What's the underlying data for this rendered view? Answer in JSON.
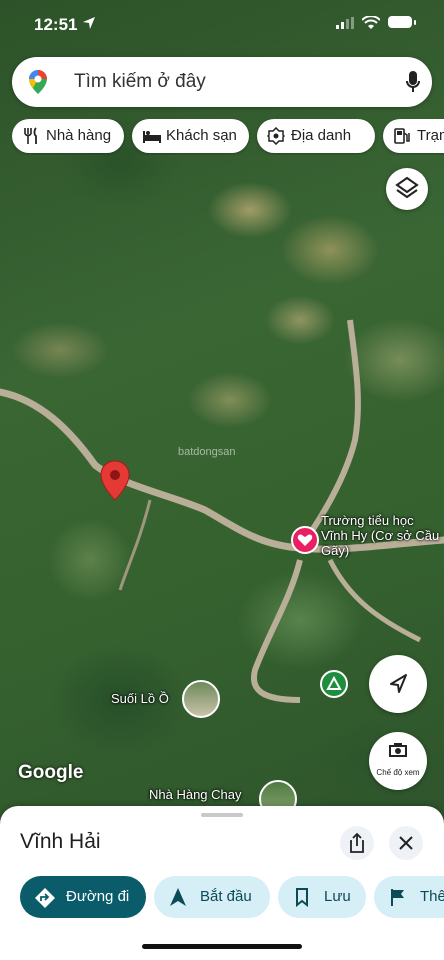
{
  "status_bar": {
    "time": "12:51",
    "location_icon": "location-arrow-icon"
  },
  "search": {
    "placeholder": "Tìm kiếm ở đây"
  },
  "chips": [
    {
      "label": "Nhà hàng",
      "icon": "fork-knife-icon"
    },
    {
      "label": "Khách sạn",
      "icon": "bed-icon"
    },
    {
      "label": "Địa danh",
      "icon": "landmark-icon"
    },
    {
      "label": "Trạm",
      "icon": "fuel-pump-icon"
    }
  ],
  "map": {
    "labels": {
      "school": "Trường tiểu học Vĩnh Hy (Cơ sở Cầu Gãy)",
      "stream": "Suối Lồ Ồ",
      "restaurant": "Nhà Hàng Chay"
    },
    "watermark": "batdongsan",
    "attribution": "Google",
    "street_view_caption": "Chế độ xem"
  },
  "place": {
    "name": "Vĩnh Hải",
    "actions": [
      {
        "label": "Đường đi",
        "icon": "directions-icon"
      },
      {
        "label": "Bắt đầu",
        "icon": "navigation-arrow-icon"
      },
      {
        "label": "Lưu",
        "icon": "bookmark-icon"
      },
      {
        "label": "Thê",
        "icon": "flag-icon"
      }
    ]
  },
  "colors": {
    "primary": "#0b5c6b",
    "secondary": "#d6eef5",
    "pin": "#e53935",
    "school_pin": "#e91e63"
  }
}
